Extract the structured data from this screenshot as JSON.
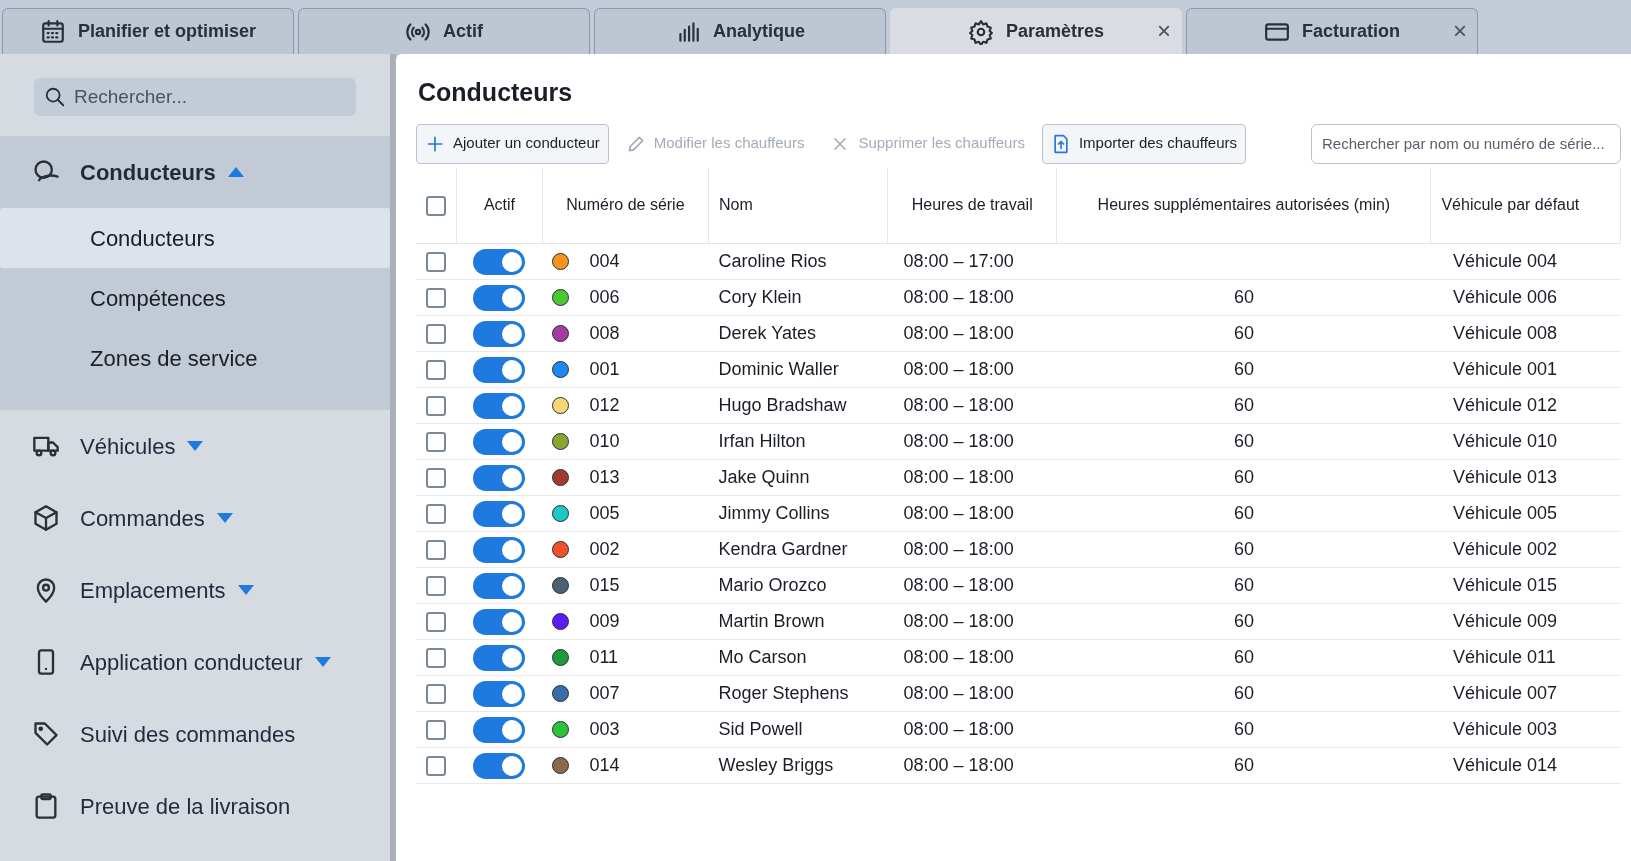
{
  "tabs": [
    {
      "label": "Planifier et optimiser",
      "kind": "calendar",
      "selected": false
    },
    {
      "label": "Actif",
      "kind": "signal",
      "selected": false
    },
    {
      "label": "Analytique",
      "kind": "bars",
      "selected": false
    },
    {
      "label": "Paramètres",
      "kind": "gear",
      "selected": true,
      "close": "×"
    },
    {
      "label": "Facturation",
      "kind": "card",
      "selected": false,
      "close": "×"
    }
  ],
  "sidebar": {
    "search": {
      "placeholder": "Rechercher..."
    },
    "items": [
      {
        "label": "Conducteurs",
        "kind": "driver",
        "expanded": true,
        "children": [
          {
            "label": "Conducteurs",
            "selected": true
          },
          {
            "label": "Compétences",
            "selected": false
          },
          {
            "label": "Zones de service",
            "selected": false
          }
        ]
      },
      {
        "label": "Véhicules",
        "kind": "truck",
        "expanded": false
      },
      {
        "label": "Commandes",
        "kind": "box",
        "expanded": false
      },
      {
        "label": "Emplacements",
        "kind": "pin",
        "expanded": false
      },
      {
        "label": "Application conducteur",
        "kind": "phone",
        "expanded": false
      },
      {
        "label": "Suivi des commandes",
        "kind": "tag"
      },
      {
        "label": "Preuve de la livraison",
        "kind": "clipboard"
      }
    ]
  },
  "main": {
    "title": "Conducteurs",
    "toolbar": [
      {
        "label": "Ajouter un conducteur",
        "kind": "add",
        "disabled": false
      },
      {
        "label": "Modifier les chauffeurs",
        "kind": "edit",
        "disabled": true
      },
      {
        "label": "Supprimer les chauffeurs",
        "kind": "delete",
        "disabled": true
      },
      {
        "label": "Importer des chauffeurs",
        "kind": "import",
        "disabled": false
      }
    ],
    "search": {
      "placeholder": "Rechercher par nom ou numéro de série..."
    },
    "table": {
      "select_all": {
        "checked": false
      },
      "columns": [
        "Actif",
        "Numéro de série",
        "Nom",
        "Heures de travail",
        "Heures supplémentaires autorisées (min)",
        "Véhicule par défaut"
      ],
      "rows": [
        {
          "checked": false,
          "on": true,
          "color": "#f7931e",
          "serial": "004",
          "name": "Caroline Rios",
          "hours": "08:00 – 17:00",
          "vehicle": "Véhicule 004"
        },
        {
          "checked": false,
          "on": true,
          "color": "#4cc734",
          "serial": "006",
          "name": "Cory Klein",
          "hours": "08:00 – 18:00",
          "overtime": "60",
          "vehicle": "Véhicule 006"
        },
        {
          "checked": false,
          "on": true,
          "color": "#a63ca0",
          "serial": "008",
          "name": "Derek Yates",
          "hours": "08:00 – 18:00",
          "overtime": "60",
          "vehicle": "Véhicule 008"
        },
        {
          "checked": false,
          "on": true,
          "color": "#1e88f0",
          "serial": "001",
          "name": "Dominic Waller",
          "hours": "08:00 – 18:00",
          "overtime": "60",
          "vehicle": "Véhicule 001"
        },
        {
          "checked": false,
          "on": true,
          "color": "#f7d774",
          "serial": "012",
          "name": "Hugo Bradshaw",
          "hours": "08:00 – 18:00",
          "overtime": "60",
          "vehicle": "Véhicule 012"
        },
        {
          "checked": false,
          "on": true,
          "color": "#86a832",
          "serial": "010",
          "name": "Irfan Hilton",
          "hours": "08:00 – 18:00",
          "overtime": "60",
          "vehicle": "Véhicule 010"
        },
        {
          "checked": false,
          "on": true,
          "color": "#a33a2e",
          "serial": "013",
          "name": "Jake Quinn",
          "hours": "08:00 – 18:00",
          "overtime": "60",
          "vehicle": "Véhicule 013"
        },
        {
          "checked": false,
          "on": true,
          "color": "#1ec6c6",
          "serial": "005",
          "name": "Jimmy Collins",
          "hours": "08:00 – 18:00",
          "overtime": "60",
          "vehicle": "Véhicule 005"
        },
        {
          "checked": false,
          "on": true,
          "color": "#f2502a",
          "serial": "002",
          "name": "Kendra Gardner",
          "hours": "08:00 – 18:00",
          "overtime": "60",
          "vehicle": "Véhicule 002"
        },
        {
          "checked": false,
          "on": true,
          "color": "#4a6274",
          "serial": "015",
          "name": "Mario Orozco",
          "hours": "08:00 – 18:00",
          "overtime": "60",
          "vehicle": "Véhicule 015"
        },
        {
          "checked": false,
          "on": true,
          "color": "#5a1ef0",
          "serial": "009",
          "name": "Martin Brown",
          "hours": "08:00 – 18:00",
          "overtime": "60",
          "vehicle": "Véhicule 009"
        },
        {
          "checked": false,
          "on": true,
          "color": "#1e9a3a",
          "serial": "011",
          "name": "Mo Carson",
          "hours": "08:00 – 18:00",
          "overtime": "60",
          "vehicle": "Véhicule 011"
        },
        {
          "checked": false,
          "on": true,
          "color": "#3a6ea8",
          "serial": "007",
          "name": "Roger Stephens",
          "hours": "08:00 – 18:00",
          "overtime": "60",
          "vehicle": "Véhicule 007"
        },
        {
          "checked": false,
          "on": true,
          "color": "#2ec23a",
          "serial": "003",
          "name": "Sid Powell",
          "hours": "08:00 – 18:00",
          "overtime": "60",
          "vehicle": "Véhicule 003"
        },
        {
          "checked": false,
          "on": true,
          "color": "#8a6a4a",
          "serial": "014",
          "name": "Wesley Briggs",
          "hours": "08:00 – 18:00",
          "overtime": "60",
          "vehicle": "Véhicule 014"
        }
      ]
    }
  }
}
